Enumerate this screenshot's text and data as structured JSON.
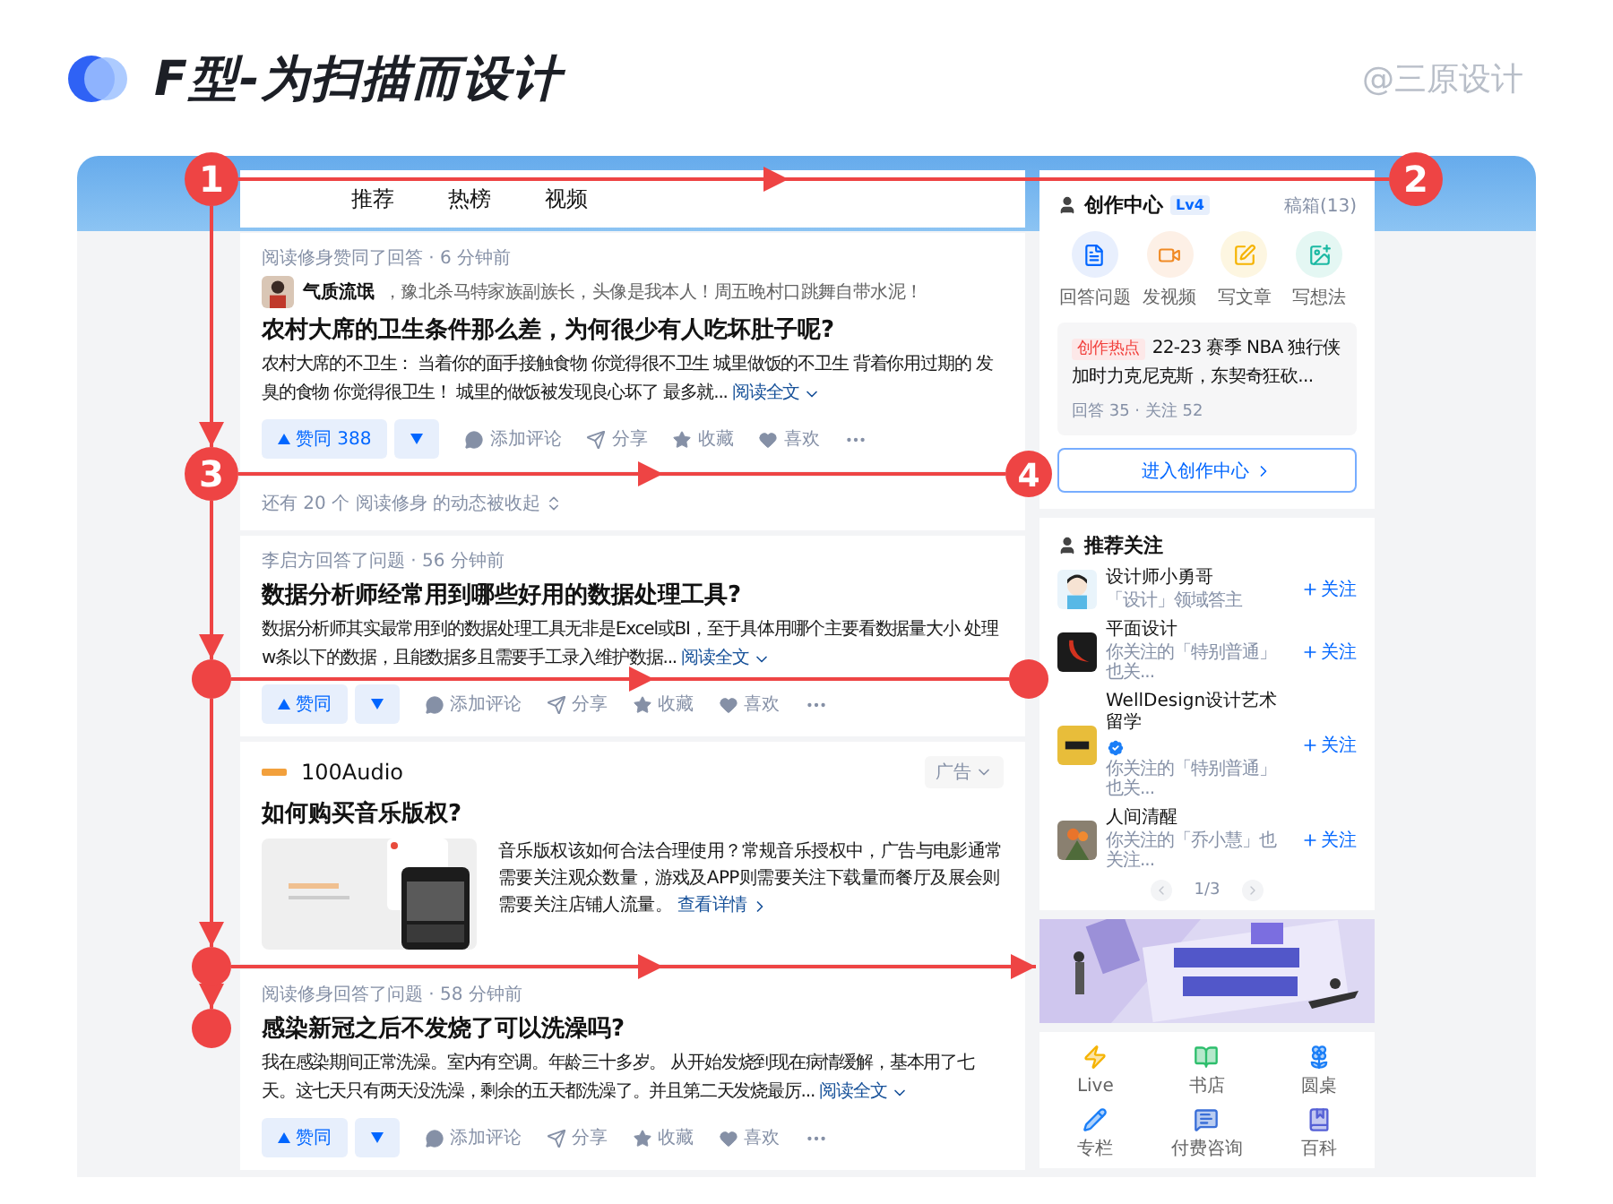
{
  "header": {
    "title": "F型-为扫描而设计",
    "credit": "@三原设计"
  },
  "feed": {
    "tabs": [
      {
        "label": "推荐",
        "selected": false
      },
      {
        "label": "热榜",
        "selected": false
      },
      {
        "label": "视频",
        "selected": false
      }
    ],
    "items": [
      {
        "kind": "answer",
        "meta": "阅读修身赞同了回答 · 6 分钟前",
        "author": {
          "name": "气质流氓",
          "bio": "，豫北杀马特家族副族长，头像是我本人！周五晚村口跳舞自带水泥！"
        },
        "title": "农村大席的卫生条件那么差，为何很少有人吃坏肚子呢?",
        "excerpt": "农村大席的不卫生： 当着你的面手接触食物 你觉得很不卫生 城里做饭的不卫生 背着你用过期的 发臭的食物 你觉得很卫生！ 城里的做饭被发现良心坏了 最多就...",
        "read_more": "阅读全文",
        "upvote": "赞同 388",
        "actions": [
          "添加评论",
          "分享",
          "收藏",
          "喜欢"
        ]
      },
      {
        "kind": "collapsed",
        "text": "还有 20 个 阅读修身 的动态被收起"
      },
      {
        "kind": "answer",
        "meta": "李启方回答了问题 · 56 分钟前",
        "title": "数据分析师经常用到哪些好用的数据处理工具?",
        "excerpt": "数据分析师其实最常用到的数据处理工具无非是Excel或BI，至于具体用哪个主要看数据量大小 处理w条以下的数据，且能数据多且需要手工录入维护数据...",
        "read_more": "阅读全文",
        "upvote": "赞同",
        "actions": [
          "添加评论",
          "分享",
          "收藏",
          "喜欢"
        ]
      },
      {
        "kind": "ad",
        "brand": "100Audio",
        "tag": "广告",
        "title": "如何购买音乐版权?",
        "text": "音乐版权该如何合法合理使用？常规音乐授权中，广告与电影通常需要关注观众数量，游戏及APP则需要关注下载量而餐厅及展会则需要关注店铺人流量。",
        "link": "查看详情"
      },
      {
        "kind": "answer",
        "meta": "阅读修身回答了问题 · 58 分钟前",
        "title": "感染新冠之后不发烧了可以洗澡吗?",
        "excerpt": "我在感染期间正常洗澡。室内有空调。年龄三十多岁。 从开始发烧到现在病情缓解，基本用了七天。这七天只有两天没洗澡，剩余的五天都洗澡了。并且第二天发烧最厉...",
        "read_more": "阅读全文",
        "upvote": "赞同",
        "actions": [
          "添加评论",
          "分享",
          "收藏",
          "喜欢"
        ]
      }
    ]
  },
  "sidebar": {
    "creator": {
      "title": "创作中心",
      "level": "Lv4",
      "drafts": "稿箱(13)",
      "shortcuts": [
        {
          "kind": "answer",
          "label": "回答问题"
        },
        {
          "kind": "video",
          "label": "发视频"
        },
        {
          "kind": "article",
          "label": "写文章"
        },
        {
          "kind": "idea",
          "label": "写想法"
        }
      ],
      "hot": {
        "tag": "创作热点",
        "text": "22-23 赛季 NBA 独行侠加时力克尼克斯，东契奇狂砍...",
        "stats": "回答 35 · 关注 52"
      },
      "button": "进入创作中心"
    },
    "recommend": {
      "title": "推荐关注",
      "pager": "1/3",
      "users": [
        {
          "name": "设计师小勇哥",
          "desc": "「设计」领域答主",
          "verified": false,
          "follow": "关注"
        },
        {
          "name": "平面设计",
          "desc": "你关注的「特别普通」也关...",
          "verified": false,
          "follow": "关注"
        },
        {
          "name": "WellDesign设计艺术留学",
          "desc": "你关注的「特别普通」也关...",
          "verified": true,
          "follow": "关注"
        },
        {
          "name": "人间清醒",
          "desc": "你关注的「乔小慧」也关注...",
          "verified": false,
          "follow": "关注"
        }
      ]
    },
    "links": [
      {
        "kind": "live",
        "label": "Live"
      },
      {
        "kind": "store",
        "label": "书店"
      },
      {
        "kind": "roundtable",
        "label": "圆桌"
      },
      {
        "kind": "column",
        "label": "专栏"
      },
      {
        "kind": "consult",
        "label": "付费咨询"
      },
      {
        "kind": "wiki",
        "label": "百科"
      }
    ]
  },
  "annotations": {
    "markers": [
      {
        "label": "1"
      },
      {
        "label": "2"
      },
      {
        "label": "3"
      },
      {
        "label": "4"
      }
    ]
  }
}
